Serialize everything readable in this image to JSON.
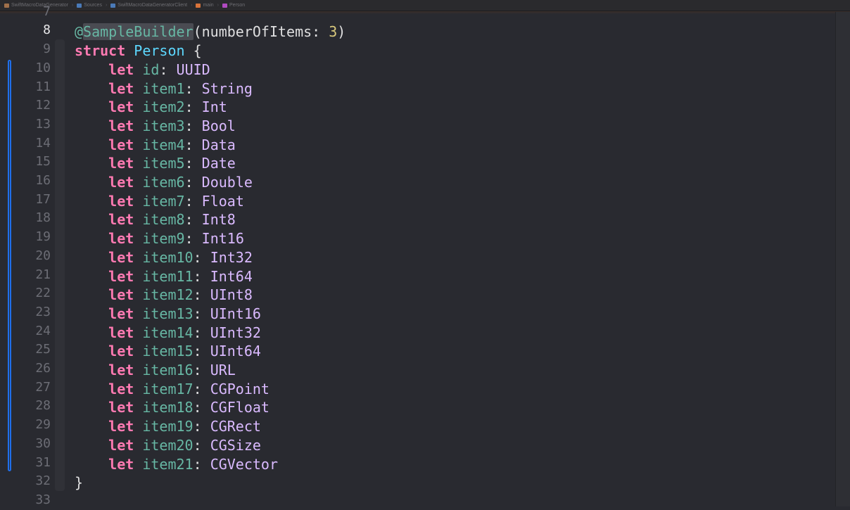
{
  "jumpbar": {
    "segments": [
      {
        "label": "SwiftMacroDataGenerator",
        "icon": "folder-icon",
        "color": "#a0704a"
      },
      {
        "label": "Sources",
        "icon": "folder-icon",
        "color": "#4a7ab8"
      },
      {
        "label": "SwiftMacroDataGeneratorClient",
        "icon": "folder-icon",
        "color": "#4a7ab8"
      },
      {
        "label": "main",
        "icon": "swift-file-icon",
        "color": "#d9733a"
      },
      {
        "label": "Person",
        "icon": "struct-icon",
        "color": "#b04ac0"
      }
    ]
  },
  "editor": {
    "current_line": "8",
    "lines": [
      {
        "number": "7"
      },
      {
        "number": "8",
        "tokens": [
          {
            "t": "@",
            "c": "macro"
          },
          {
            "t": "SampleBuilder",
            "c": "macro macro-name"
          },
          {
            "t": "(numberOfItems: ",
            "c": "plain"
          },
          {
            "t": "3",
            "c": "num"
          },
          {
            "t": ")",
            "c": "plain"
          }
        ]
      },
      {
        "number": "9",
        "tokens": [
          {
            "t": "struct",
            "c": "kw"
          },
          {
            "t": " ",
            "c": "plain"
          },
          {
            "t": "Person",
            "c": "type-decl"
          },
          {
            "t": " {",
            "c": "plain"
          }
        ]
      },
      {
        "number": "10",
        "indent": true,
        "name": "id",
        "type": "UUID"
      },
      {
        "number": "11",
        "indent": true,
        "name": "item1",
        "type": "String"
      },
      {
        "number": "12",
        "indent": true,
        "name": "item2",
        "type": "Int"
      },
      {
        "number": "13",
        "indent": true,
        "name": "item3",
        "type": "Bool"
      },
      {
        "number": "14",
        "indent": true,
        "name": "item4",
        "type": "Data"
      },
      {
        "number": "15",
        "indent": true,
        "name": "item5",
        "type": "Date"
      },
      {
        "number": "16",
        "indent": true,
        "name": "item6",
        "type": "Double"
      },
      {
        "number": "17",
        "indent": true,
        "name": "item7",
        "type": "Float"
      },
      {
        "number": "18",
        "indent": true,
        "name": "item8",
        "type": "Int8"
      },
      {
        "number": "19",
        "indent": true,
        "name": "item9",
        "type": "Int16"
      },
      {
        "number": "20",
        "indent": true,
        "name": "item10",
        "type": "Int32"
      },
      {
        "number": "21",
        "indent": true,
        "name": "item11",
        "type": "Int64"
      },
      {
        "number": "22",
        "indent": true,
        "name": "item12",
        "type": "UInt8"
      },
      {
        "number": "23",
        "indent": true,
        "name": "item13",
        "type": "UInt16"
      },
      {
        "number": "24",
        "indent": true,
        "name": "item14",
        "type": "UInt32"
      },
      {
        "number": "25",
        "indent": true,
        "name": "item15",
        "type": "UInt64"
      },
      {
        "number": "26",
        "indent": true,
        "name": "item16",
        "type": "URL"
      },
      {
        "number": "27",
        "indent": true,
        "name": "item17",
        "type": "CGPoint"
      },
      {
        "number": "28",
        "indent": true,
        "name": "item18",
        "type": "CGFloat"
      },
      {
        "number": "29",
        "indent": true,
        "name": "item19",
        "type": "CGRect"
      },
      {
        "number": "30",
        "indent": true,
        "name": "item20",
        "type": "CGSize"
      },
      {
        "number": "31",
        "indent": true,
        "name": "item21",
        "type": "CGVector"
      },
      {
        "number": "32",
        "tokens": [
          {
            "t": "}",
            "c": "plain"
          }
        ]
      },
      {
        "number": "33",
        "tokens": []
      }
    ],
    "keyword_let": "let",
    "colors": {
      "background": "#292a30",
      "keyword": "#ff7ab2",
      "property": "#67b7a4",
      "type": "#dabaff",
      "type_declaration": "#5dd8ff",
      "number": "#d9c97c",
      "change_bar": "#1f6feb"
    }
  }
}
